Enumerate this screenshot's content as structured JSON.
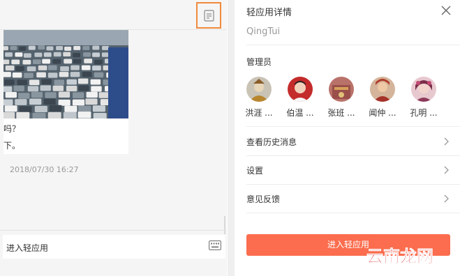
{
  "chat": {
    "message_line1": "吗？",
    "message_line2": "下。",
    "timestamp": "2018/07/30 16:27",
    "enter_app_link": "进入轻应用",
    "notes_icon": "notes-icon",
    "keyboard_icon": "keyboard-icon"
  },
  "panel": {
    "title": "轻应用详情",
    "app_name": "QingTui",
    "admins_label": "管理员",
    "admins": [
      {
        "name": "洪涯 ..."
      },
      {
        "name": "伯温 ..."
      },
      {
        "name": "张班 ..."
      },
      {
        "name": "闻仲 ..."
      },
      {
        "name": "孔明 ..."
      }
    ],
    "rows": [
      {
        "label": "查看历史消息"
      },
      {
        "label": "设置"
      },
      {
        "label": "意见反馈"
      }
    ],
    "enter_button": "进入轻应用"
  },
  "watermark": "云南龙网",
  "colors": {
    "accent_button": "#fb6d4e",
    "highlight_border": "#f08a3c",
    "watermark_red": "#d9262c"
  }
}
